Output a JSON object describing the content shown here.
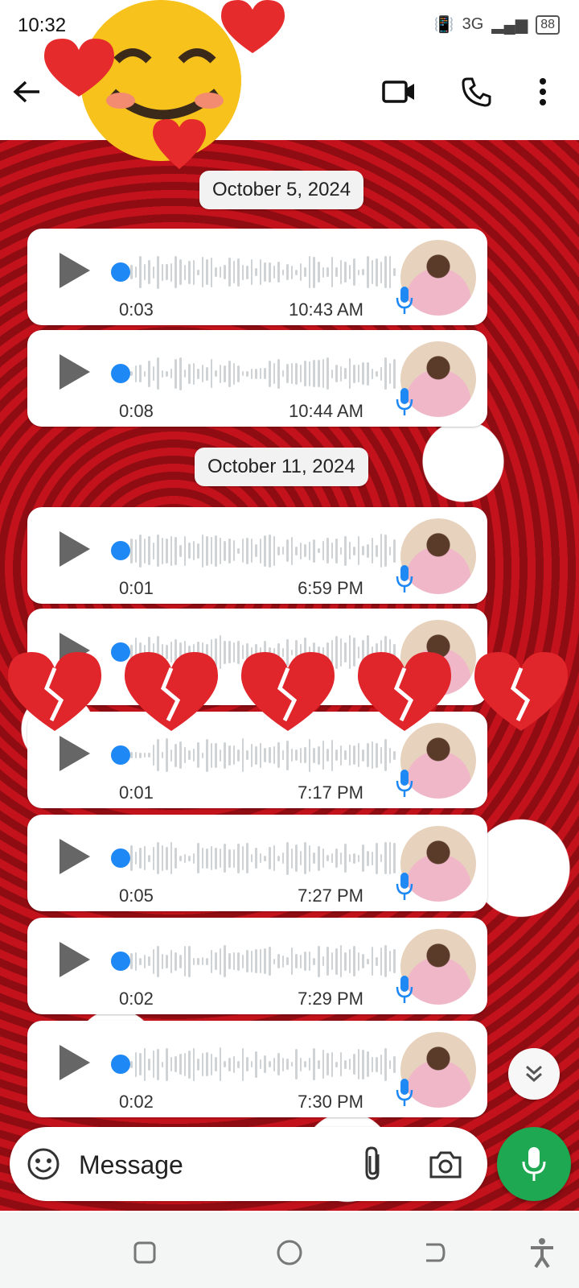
{
  "status_bar": {
    "time": "10:32",
    "network": "3G",
    "battery": "88"
  },
  "date_chips": [
    "October 5, 2024",
    "October 11, 2024"
  ],
  "messages": [
    {
      "duration": "0:03",
      "time": "10:43 AM"
    },
    {
      "duration": "0:08",
      "time": "10:44 AM"
    },
    {
      "duration": "0:01",
      "time": "6:59 PM"
    },
    {
      "duration": "",
      "time": ""
    },
    {
      "duration": "0:01",
      "time": "7:17 PM"
    },
    {
      "duration": "0:05",
      "time": "7:27 PM"
    },
    {
      "duration": "0:02",
      "time": "7:29 PM"
    },
    {
      "duration": "0:02",
      "time": "7:30 PM"
    }
  ],
  "composer": {
    "placeholder": "Message"
  },
  "colors": {
    "accent_green": "#1da851",
    "play_dot_blue": "#1e88f5"
  },
  "icons": [
    "back-arrow-icon",
    "video-call-icon",
    "phone-icon",
    "more-vert-icon",
    "emoji-icon",
    "attach-icon",
    "camera-icon",
    "mic-icon",
    "chevron-double-down-icon"
  ]
}
